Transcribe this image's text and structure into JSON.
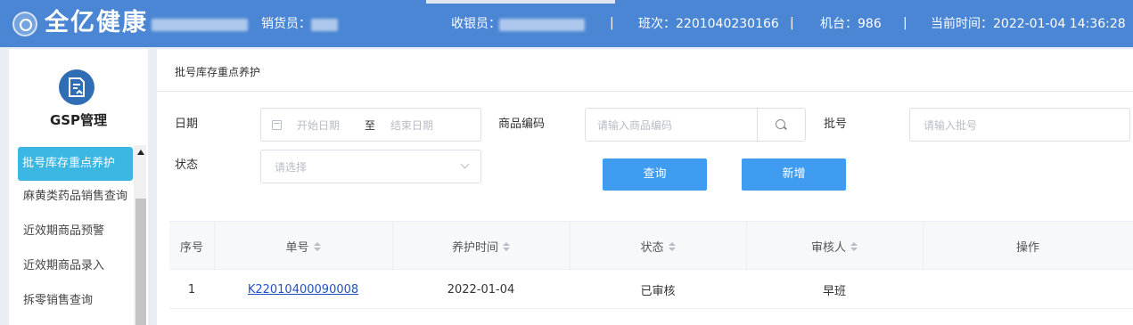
{
  "header": {
    "brand": "全亿健康",
    "salesperson_label": "销货员：",
    "cashier_label": "收银员：",
    "shift_label": "班次：2201040230166",
    "terminal_label": "机台：986",
    "time_label": "当前时间：2022-01-04 14:36:28",
    "separator": "|"
  },
  "sidebar": {
    "module_title": "GSP管理",
    "items": [
      {
        "label": "批号库存重点养护",
        "active": true
      },
      {
        "label": "麻黄类药品销售查询"
      },
      {
        "label": "近效期商品预警"
      },
      {
        "label": "近效期商品录入"
      },
      {
        "label": "拆零销售查询"
      }
    ]
  },
  "main": {
    "page_title": "批号库存重点养护",
    "filters": {
      "date_label": "日期",
      "start_placeholder": "开始日期",
      "range_separator": "至",
      "end_placeholder": "结束日期",
      "code_label": "商品编码",
      "code_placeholder": "请输入商品编码",
      "batch_label": "批号",
      "batch_placeholder": "请输入批号",
      "status_label": "状态",
      "status_placeholder": "请选择"
    },
    "buttons": {
      "query": "查询",
      "add": "新增"
    },
    "table": {
      "columns": [
        "序号",
        "单号",
        "养护时间",
        "状态",
        "审核人",
        "操作"
      ],
      "rows": [
        {
          "index": "1",
          "order_no": "K22010400090008",
          "time": "2022-01-04",
          "status": "已审核",
          "reviewer": "早班",
          "action": ""
        }
      ]
    }
  }
}
